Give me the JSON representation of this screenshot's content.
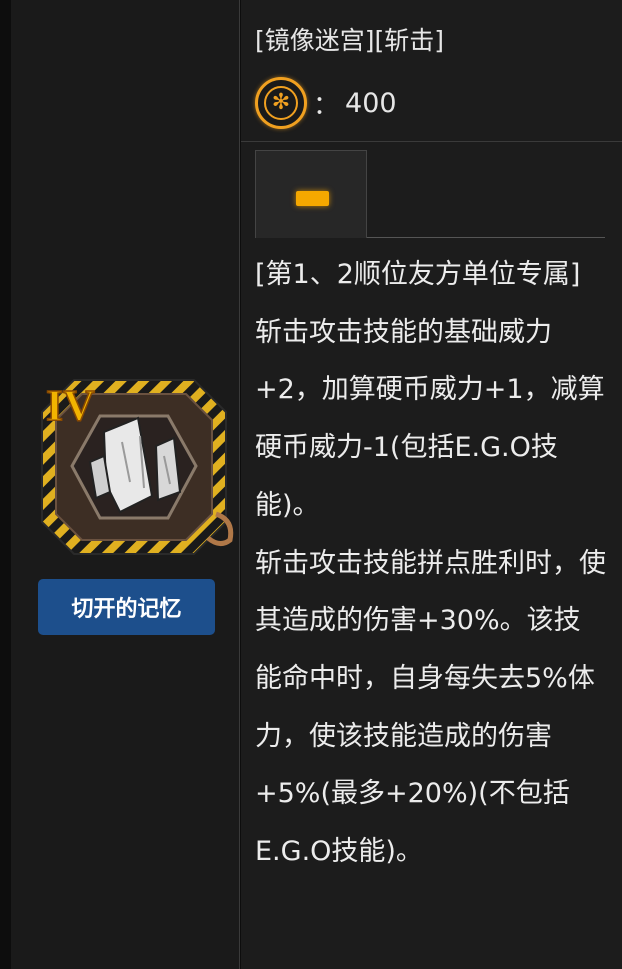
{
  "gift": {
    "grade": "IV",
    "name": "切开的记忆",
    "icon": "cut-memory-icon"
  },
  "header": {
    "tags": "[镜像迷宫][斩击]",
    "cost_icon": "coin-icon",
    "cost_separator": "：",
    "cost_value": "400"
  },
  "tabs": [
    {
      "icon": "minus-bar-icon",
      "color": "#f5a800"
    }
  ],
  "description": {
    "lines": [
      "[第1、2顺位友方单位专属]",
      "斩击攻击技能的基础威力+2，加算硬币威力+1，减算硬币威力-1(包括E.G.O技能)。",
      "斩击攻击技能拼点胜利时，使其造成的伤害+30%。该技能命中时，自身每失去5%体力，使该技能造成的伤害+5%(最多+20%)(不包括E.G.O技能)。"
    ]
  },
  "colors": {
    "accent": "#f0a020",
    "name_badge": "#1d4f8c",
    "background": "#1a1a1a"
  }
}
